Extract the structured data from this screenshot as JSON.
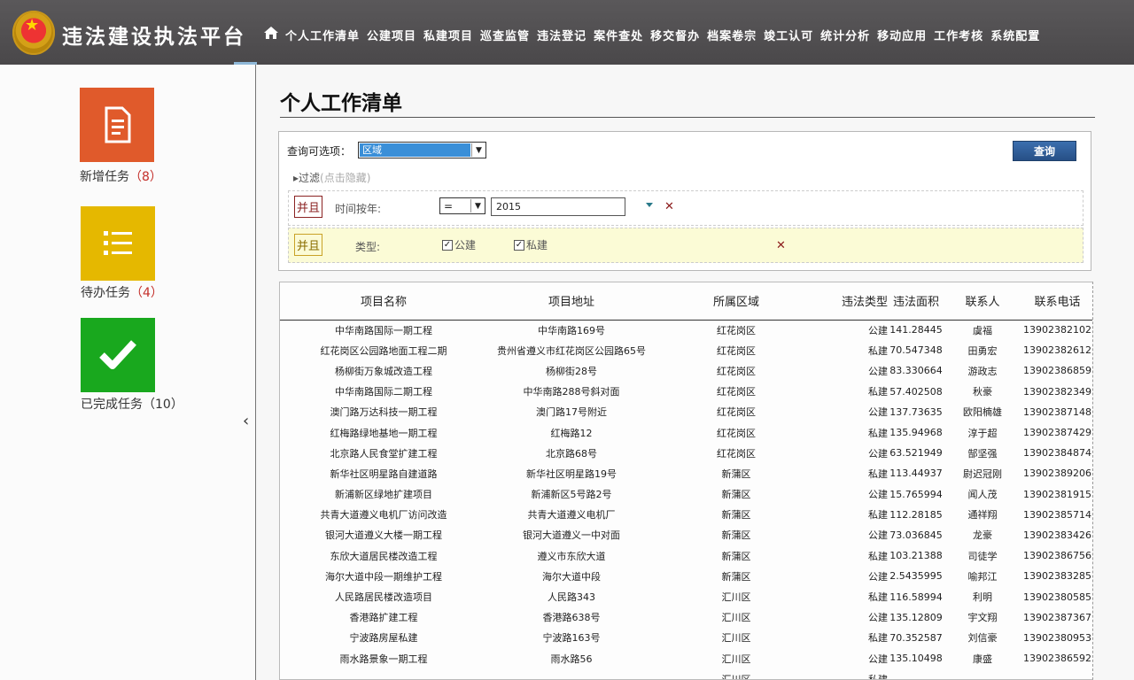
{
  "app": {
    "title": "违法建设执法平台"
  },
  "nav": {
    "items": [
      "个人工作清单",
      "公建项目",
      "私建项目",
      "巡查监管",
      "违法登记",
      "案件查处",
      "移交督办",
      "档案卷宗",
      "竣工认可",
      "统计分析",
      "移动应用",
      "工作考核",
      "系统配置"
    ]
  },
  "sidebar": {
    "tiles": [
      {
        "label": "新增任务",
        "count": "（8）",
        "color": "#e05a2b",
        "icon": "document-icon"
      },
      {
        "label": "待办任务",
        "count": "（4）",
        "color": "#e5b800",
        "icon": "list-icon"
      },
      {
        "label": "已完成任务",
        "count": "（10）",
        "color": "#19a81e",
        "icon": "checkmark-icon"
      }
    ]
  },
  "main": {
    "title": "个人工作清单",
    "query": {
      "label": "查询可选项：",
      "selected": "区域",
      "button": "查询",
      "filter_toggle": "过滤",
      "filter_hint": "(点击隐藏)"
    },
    "conditions": {
      "row1": {
        "and": "并且",
        "field": "时间按年:",
        "operator": "=",
        "value": "2015"
      },
      "row2": {
        "and": "并且",
        "field": "类型:",
        "options": [
          "公建",
          "私建"
        ]
      }
    },
    "table": {
      "headers": [
        "项目名称",
        "项目地址",
        "所属区域",
        "违法类型",
        "违法面积",
        "联系人",
        "联系电话"
      ],
      "rows": [
        [
          "中华南路国际一期工程",
          "中华南路169号",
          "红花岗区",
          "公建",
          "141.28445",
          "虞福",
          "13902382102"
        ],
        [
          "红花岗区公园路地面工程二期",
          "贵州省遵义市红花岗区公园路65号",
          "红花岗区",
          "私建",
          "70.547348",
          "田勇宏",
          "13902382612"
        ],
        [
          "杨柳街万象城改造工程",
          "杨柳街28号",
          "红花岗区",
          "公建",
          "83.330664",
          "游政志",
          "13902386859"
        ],
        [
          "中华南路国际二期工程",
          "中华南路288号斜对面",
          "红花岗区",
          "私建",
          "57.402508",
          "秋豪",
          "13902382349"
        ],
        [
          "澳门路万达科技一期工程",
          "澳门路17号附近",
          "红花岗区",
          "公建",
          "137.73635",
          "欧阳楠雄",
          "13902387148"
        ],
        [
          "红梅路绿地基地一期工程",
          "红梅路12",
          "红花岗区",
          "私建",
          "135.94968",
          "淳于超",
          "13902387429"
        ],
        [
          "北京路人民食堂扩建工程",
          "北京路68号",
          "红花岗区",
          "公建",
          "63.521949",
          "郜坚强",
          "13902384874"
        ],
        [
          "新华社区明星路自建道路",
          "新华社区明星路19号",
          "新蒲区",
          "私建",
          "113.44937",
          "尉迟冠刚",
          "13902389206"
        ],
        [
          "新浦新区绿地扩建项目",
          "新浦新区5号路2号",
          "新蒲区",
          "公建",
          "15.765994",
          "闻人茂",
          "13902381915"
        ],
        [
          "共青大道遵义电机厂访问改造",
          "共青大道遵义电机厂",
          "新蒲区",
          "私建",
          "112.28185",
          "通祥翔",
          "13902385714"
        ],
        [
          "银河大道遵义大楼一期工程",
          "银河大道遵义一中对面",
          "新蒲区",
          "公建",
          "73.036845",
          "龙豪",
          "13902383426"
        ],
        [
          "东欣大道居民楼改造工程",
          "遵义市东欣大道",
          "新蒲区",
          "私建",
          "103.21388",
          "司徒学",
          "13902386756"
        ],
        [
          "海尔大道中段一期维护工程",
          "海尔大道中段",
          "新蒲区",
          "公建",
          "2.5435995",
          "喻邦江",
          "13902383285"
        ],
        [
          "人民路居民楼改造项目",
          "人民路343",
          "汇川区",
          "私建",
          "116.58994",
          "利明",
          "13902380585"
        ],
        [
          "香港路扩建工程",
          "香港路638号",
          "汇川区",
          "公建",
          "135.12809",
          "宇文翔",
          "13902387367"
        ],
        [
          "宁波路房屋私建",
          "宁波路163号",
          "汇川区",
          "私建",
          "70.352587",
          "刘信豪",
          "13902380953"
        ],
        [
          "雨水路景象一期工程",
          "雨水路56",
          "汇川区",
          "公建",
          "135.10498",
          "康盛",
          "13902386592"
        ],
        [
          "",
          "",
          "汇川区",
          "私建",
          "",
          "",
          ""
        ]
      ]
    }
  },
  "colors": {
    "header_bg": "#4f4d4f",
    "accent_blue": "#2a5a96"
  }
}
